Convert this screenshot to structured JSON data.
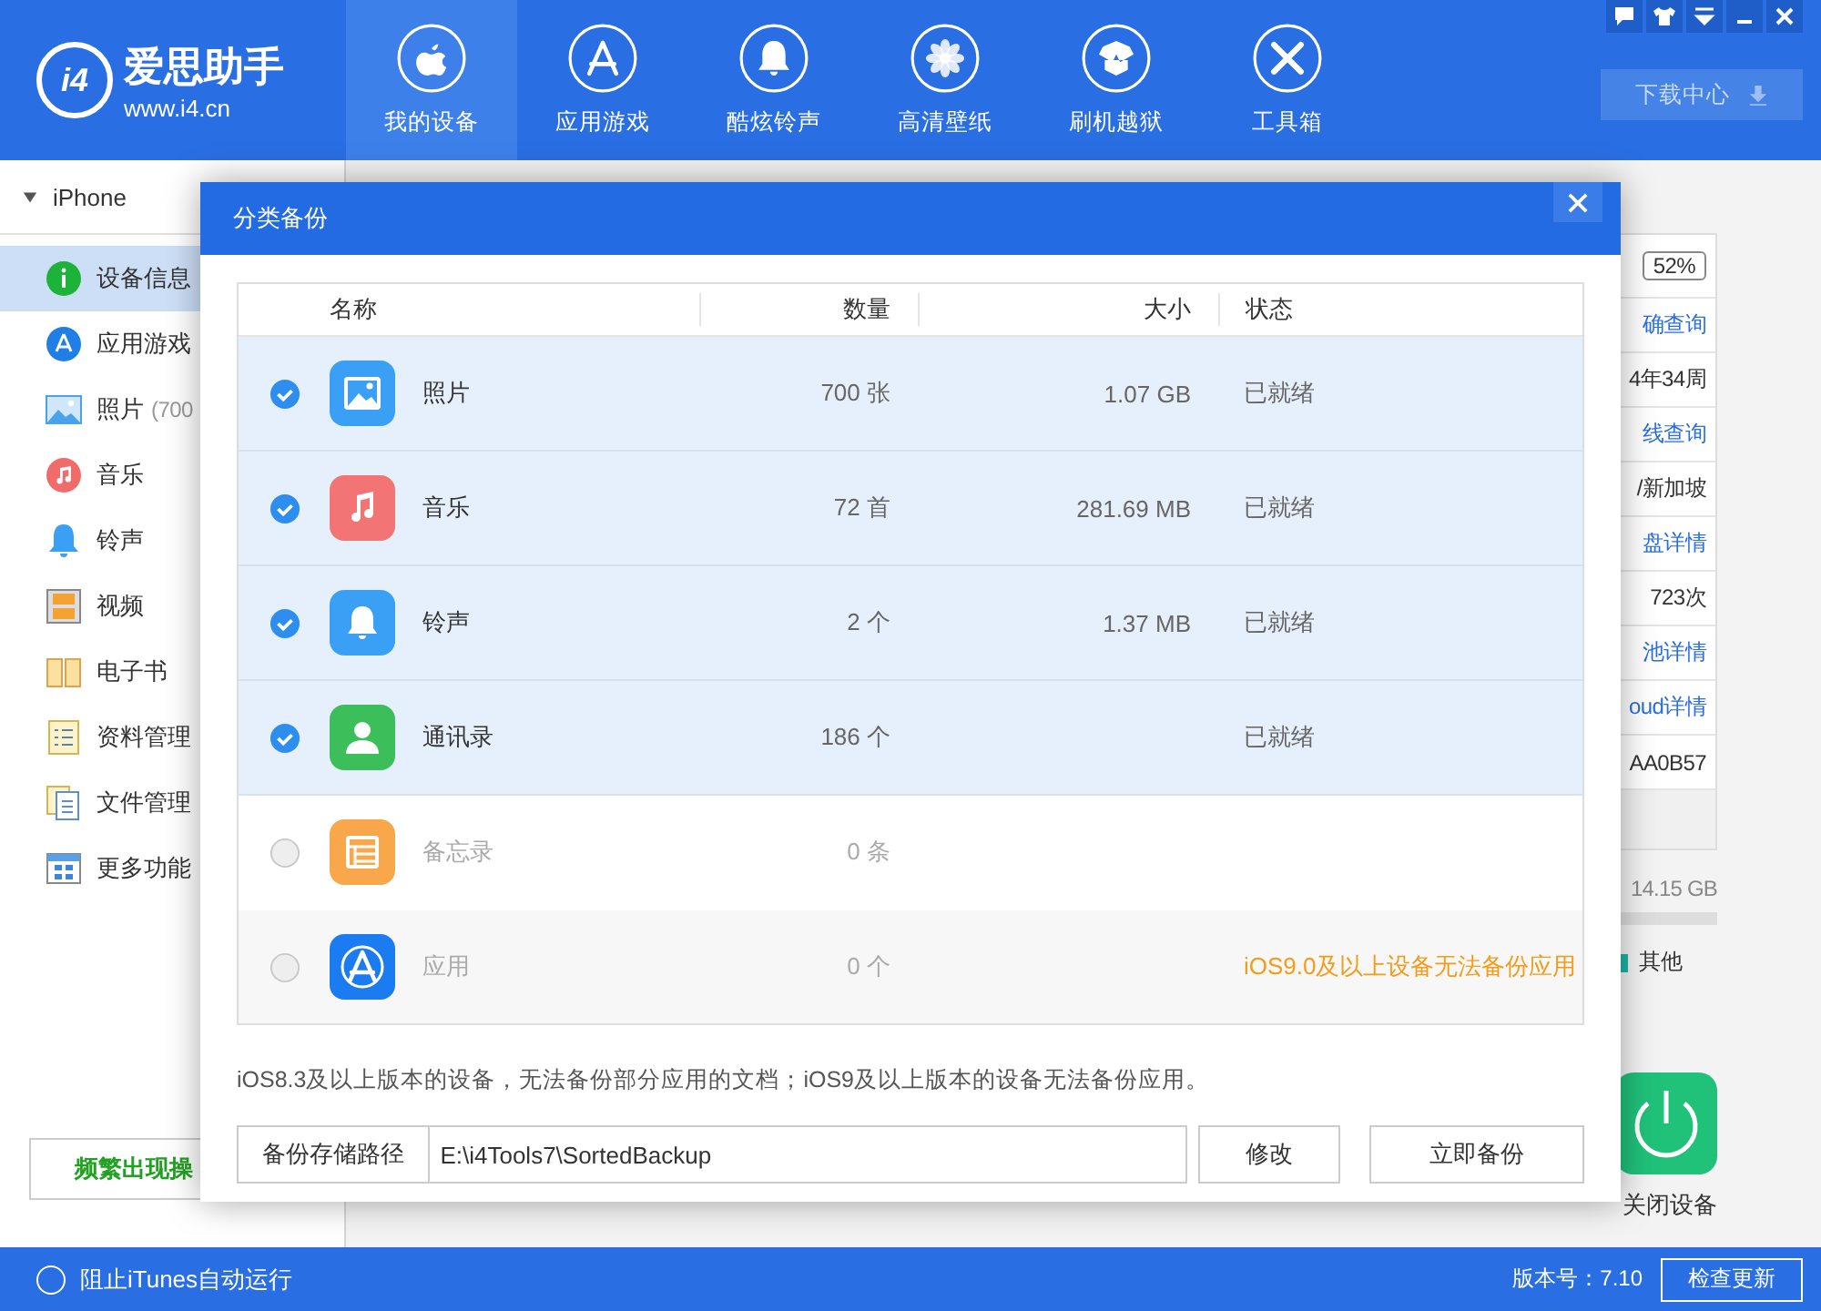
{
  "app": {
    "logo_mark": "i4",
    "logo_text": "爱思助手",
    "logo_url": "www.i4.cn"
  },
  "nav": [
    {
      "label": "我的设备",
      "selected": true
    },
    {
      "label": "应用游戏",
      "selected": false
    },
    {
      "label": "酷炫铃声",
      "selected": false
    },
    {
      "label": "高清壁纸",
      "selected": false
    },
    {
      "label": "刷机越狱",
      "selected": false
    },
    {
      "label": "工具箱",
      "selected": false
    }
  ],
  "download_button": {
    "label": "下载中心"
  },
  "sidebar": {
    "device": "iPhone",
    "expanded": true,
    "items": [
      {
        "label": "设备信息",
        "selected": true
      },
      {
        "label": "应用游戏",
        "selected": false
      },
      {
        "label": "照片",
        "count": "(700",
        "selected": false
      },
      {
        "label": "音乐",
        "selected": false
      },
      {
        "label": "铃声",
        "selected": false
      },
      {
        "label": "视频",
        "selected": false
      },
      {
        "label": "电子书",
        "selected": false
      },
      {
        "label": "资料管理",
        "selected": false
      },
      {
        "label": "文件管理",
        "selected": false
      },
      {
        "label": "更多功能",
        "selected": false
      }
    ],
    "action_button": "频繁出现操"
  },
  "device_panel": {
    "battery": "52%",
    "rows": [
      {
        "text": "确查询",
        "kind": "link"
      },
      {
        "text": "4年34周",
        "kind": "text"
      },
      {
        "text": "线查询",
        "kind": "link"
      },
      {
        "text": "/新加坡",
        "kind": "text"
      },
      {
        "text": "盘详情",
        "kind": "link"
      },
      {
        "text": "723次",
        "kind": "text"
      },
      {
        "text": "池详情",
        "kind": "link"
      },
      {
        "text": "oud详情",
        "kind": "link"
      },
      {
        "text": "AA0B57",
        "kind": "text"
      }
    ],
    "storage": "14.15 GB",
    "legend": "其他",
    "power_label": "关闭设备"
  },
  "dialog": {
    "title": "分类备份",
    "columns": [
      "名称",
      "数量",
      "大小",
      "状态"
    ],
    "rows": [
      {
        "name": "照片",
        "count": "700 张",
        "size": "1.07 GB",
        "status": "已就绪",
        "kind": "normal",
        "selected": true
      },
      {
        "name": "音乐",
        "count": "72 首",
        "size": "281.69 MB",
        "status": "已就绪",
        "kind": "normal",
        "selected": true
      },
      {
        "name": "铃声",
        "count": "2 个",
        "size": "1.37 MB",
        "status": "已就绪",
        "kind": "normal",
        "selected": true
      },
      {
        "name": "通讯录",
        "count": "186 个",
        "status": "已就绪",
        "kind": "normal",
        "selected": true
      },
      {
        "name": "备忘录",
        "count": "0 条",
        "selected": false
      },
      {
        "name": "应用",
        "count": "0 个",
        "status": "iOS9.0及以上设备无法备份应用",
        "kind": "warning",
        "selected": false
      }
    ],
    "note": "iOS8.3及以上版本的设备，无法备份部分应用的文档；iOS9及以上版本的设备无法备份应用。",
    "path_label": "备份存储路径",
    "path": "E:\\i4Tools7\\SortedBackup",
    "modify_button": "修改",
    "backup_button": "立即备份"
  },
  "status_bar": {
    "itunes_block": {
      "label": "阻止iTunes自动运行",
      "checked": false
    },
    "version": "版本号：7.10",
    "update_button": "检查更新"
  }
}
